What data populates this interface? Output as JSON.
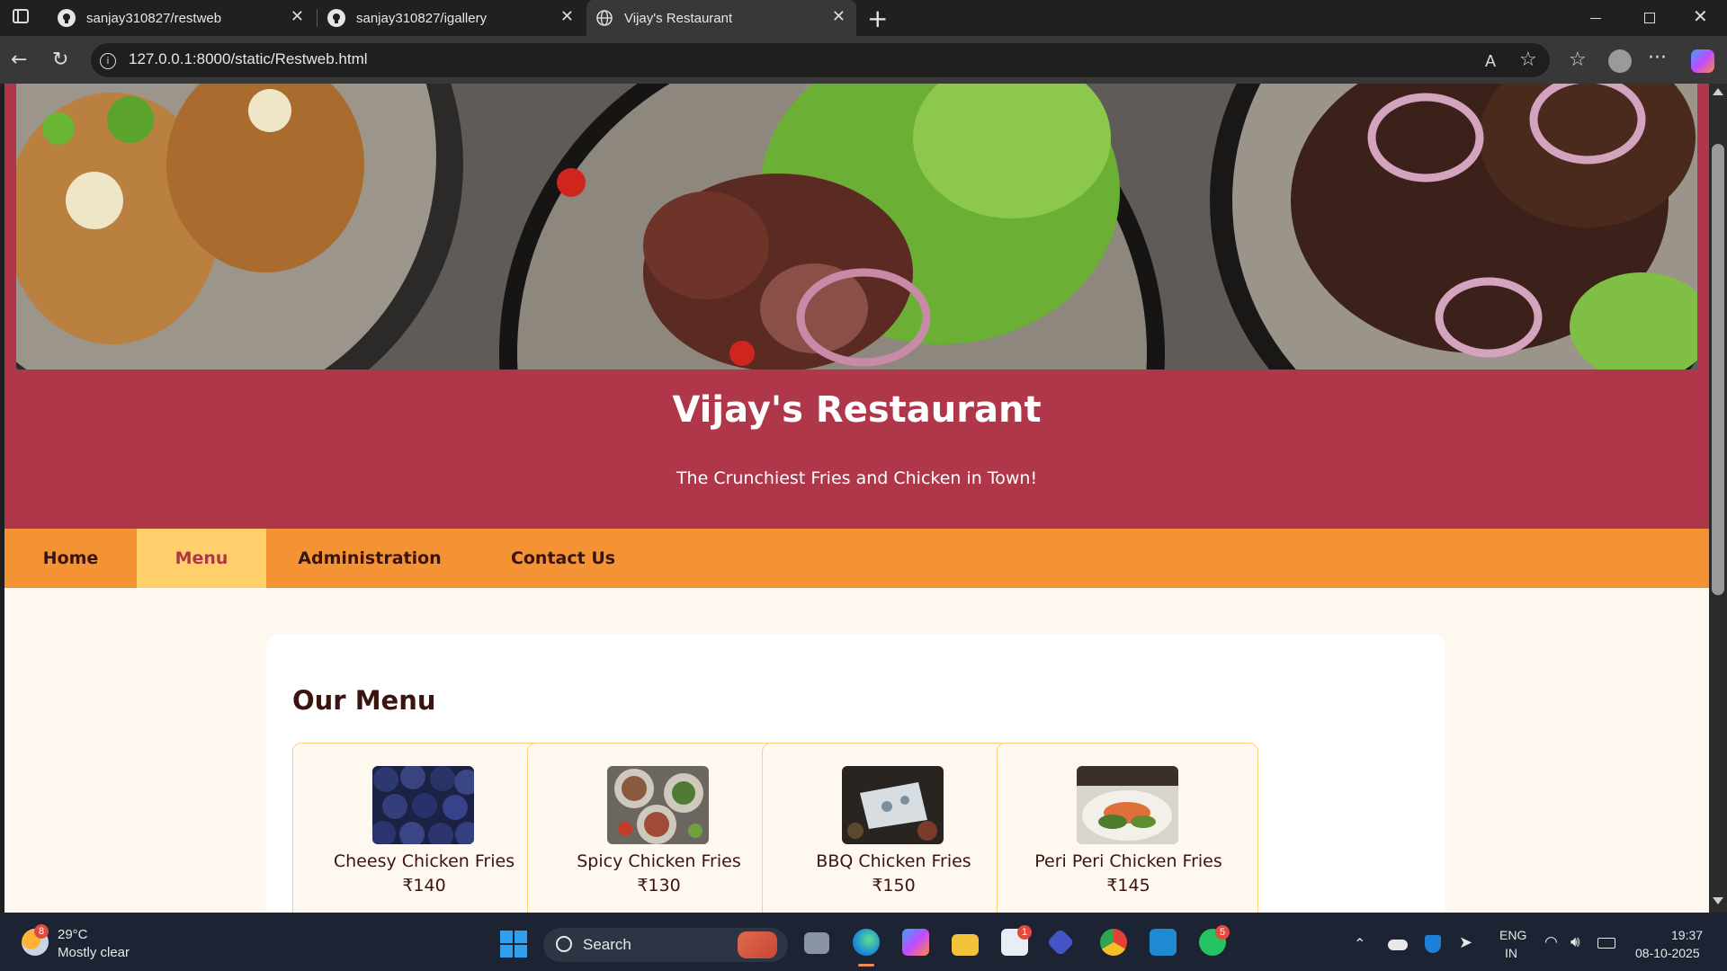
{
  "browser": {
    "tabs": [
      {
        "label": "sanjay310827/restweb"
      },
      {
        "label": "sanjay310827/igallery"
      },
      {
        "label": "Vijay's Restaurant"
      }
    ],
    "url": "127.0.0.1:8000/static/Restweb.html"
  },
  "site": {
    "title": "Vijay's Restaurant",
    "tagline": "The Crunchiest Fries and Chicken in Town!"
  },
  "nav": {
    "items": [
      {
        "label": "Home"
      },
      {
        "label": "Menu"
      },
      {
        "label": "Administration"
      },
      {
        "label": "Contact Us"
      }
    ],
    "active": "Menu"
  },
  "menu": {
    "heading": "Our Menu",
    "items": [
      {
        "name": "Cheesy Chicken Fries",
        "price": "₹140"
      },
      {
        "name": "Spicy Chicken Fries",
        "price": "₹130"
      },
      {
        "name": "BBQ Chicken Fries",
        "price": "₹150"
      },
      {
        "name": "Peri Peri Chicken Fries",
        "price": "₹145"
      }
    ]
  },
  "taskbar": {
    "weather": {
      "temp": "29°C",
      "condition": "Mostly clear",
      "badge": "8"
    },
    "search_label": "Search",
    "language": {
      "line1": "ENG",
      "line2": "IN"
    },
    "time": "19:37",
    "date": "08-10-2025",
    "store_badge": "1",
    "whatsapp_badge": "5"
  },
  "colors": {
    "header": "#b0374a",
    "nav": "#f49334",
    "nav_active": "#ffcf6b",
    "page_bg": "#fff8f0"
  }
}
